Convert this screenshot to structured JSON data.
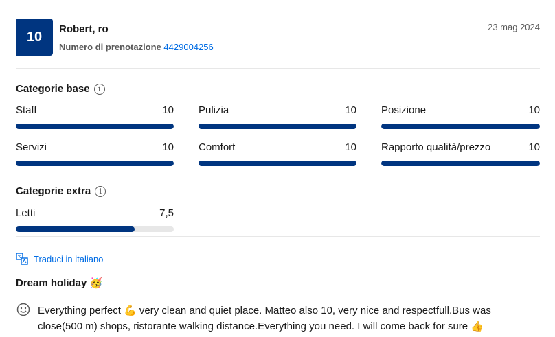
{
  "review": {
    "score": "10",
    "reviewer": "Robert, ro",
    "booking_label": "Numero di prenotazione",
    "booking_number": "4429004256",
    "date": "23 mag 2024"
  },
  "base": {
    "title": "Categorie base",
    "items": [
      {
        "label": "Staff",
        "score": "10",
        "value": 1.0
      },
      {
        "label": "Pulizia",
        "score": "10",
        "value": 1.0
      },
      {
        "label": "Posizione",
        "score": "10",
        "value": 1.0
      },
      {
        "label": "Servizi",
        "score": "10",
        "value": 1.0
      },
      {
        "label": "Comfort",
        "score": "10",
        "value": 1.0
      },
      {
        "label": "Rapporto qualità/prezzo",
        "score": "10",
        "value": 1.0
      }
    ]
  },
  "extra": {
    "title": "Categorie extra",
    "items": [
      {
        "label": "Letti",
        "score": "7,5",
        "value": 0.75
      }
    ]
  },
  "translate_label": "Traduci in italiano",
  "review_title": "Dream holiday 🥳",
  "review_text": "Everything perfect 💪 very clean and quiet place. Matteo also 10, very nice and respectfull.Bus was close(500 m) shops, ristorante walking distance.Everything you need. I will come back for sure 👍",
  "colors": {
    "brand": "#003580",
    "link": "#006ce4",
    "track": "#e7e7e7"
  }
}
